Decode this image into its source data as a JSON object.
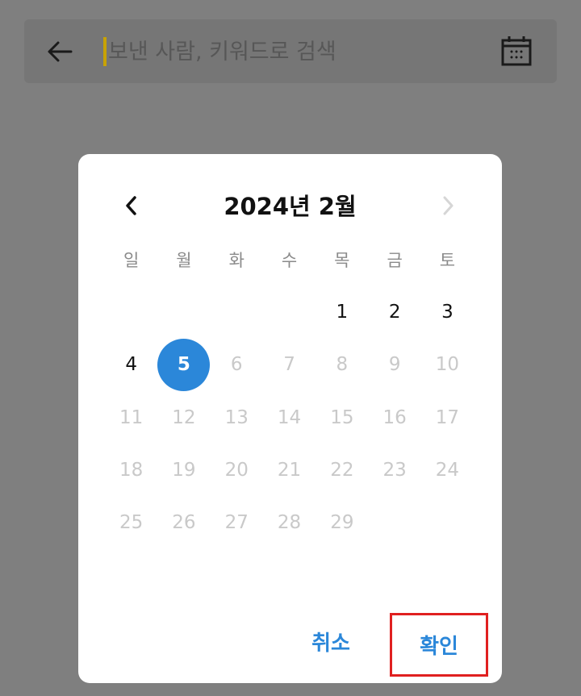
{
  "search": {
    "placeholder": "보낸 사람, 키워드로 검색"
  },
  "calendar": {
    "title": "2024년 2월",
    "weekdays": [
      "일",
      "월",
      "화",
      "수",
      "목",
      "금",
      "토"
    ],
    "days": [
      {
        "label": "",
        "state": "empty"
      },
      {
        "label": "",
        "state": "empty"
      },
      {
        "label": "",
        "state": "empty"
      },
      {
        "label": "",
        "state": "empty"
      },
      {
        "label": "1",
        "state": "enabled"
      },
      {
        "label": "2",
        "state": "enabled"
      },
      {
        "label": "3",
        "state": "enabled"
      },
      {
        "label": "4",
        "state": "enabled"
      },
      {
        "label": "5",
        "state": "selected"
      },
      {
        "label": "6",
        "state": "disabled"
      },
      {
        "label": "7",
        "state": "disabled"
      },
      {
        "label": "8",
        "state": "disabled"
      },
      {
        "label": "9",
        "state": "disabled"
      },
      {
        "label": "10",
        "state": "disabled"
      },
      {
        "label": "11",
        "state": "disabled"
      },
      {
        "label": "12",
        "state": "disabled"
      },
      {
        "label": "13",
        "state": "disabled"
      },
      {
        "label": "14",
        "state": "disabled"
      },
      {
        "label": "15",
        "state": "disabled"
      },
      {
        "label": "16",
        "state": "disabled"
      },
      {
        "label": "17",
        "state": "disabled"
      },
      {
        "label": "18",
        "state": "disabled"
      },
      {
        "label": "19",
        "state": "disabled"
      },
      {
        "label": "20",
        "state": "disabled"
      },
      {
        "label": "21",
        "state": "disabled"
      },
      {
        "label": "22",
        "state": "disabled"
      },
      {
        "label": "23",
        "state": "disabled"
      },
      {
        "label": "24",
        "state": "disabled"
      },
      {
        "label": "25",
        "state": "disabled"
      },
      {
        "label": "26",
        "state": "disabled"
      },
      {
        "label": "27",
        "state": "disabled"
      },
      {
        "label": "28",
        "state": "disabled"
      },
      {
        "label": "29",
        "state": "disabled"
      }
    ]
  },
  "actions": {
    "cancel_label": "취소",
    "confirm_label": "확인"
  },
  "colors": {
    "accent": "#2b87d9",
    "overlay": "#7f7f7f",
    "highlight_box": "#e02020"
  }
}
